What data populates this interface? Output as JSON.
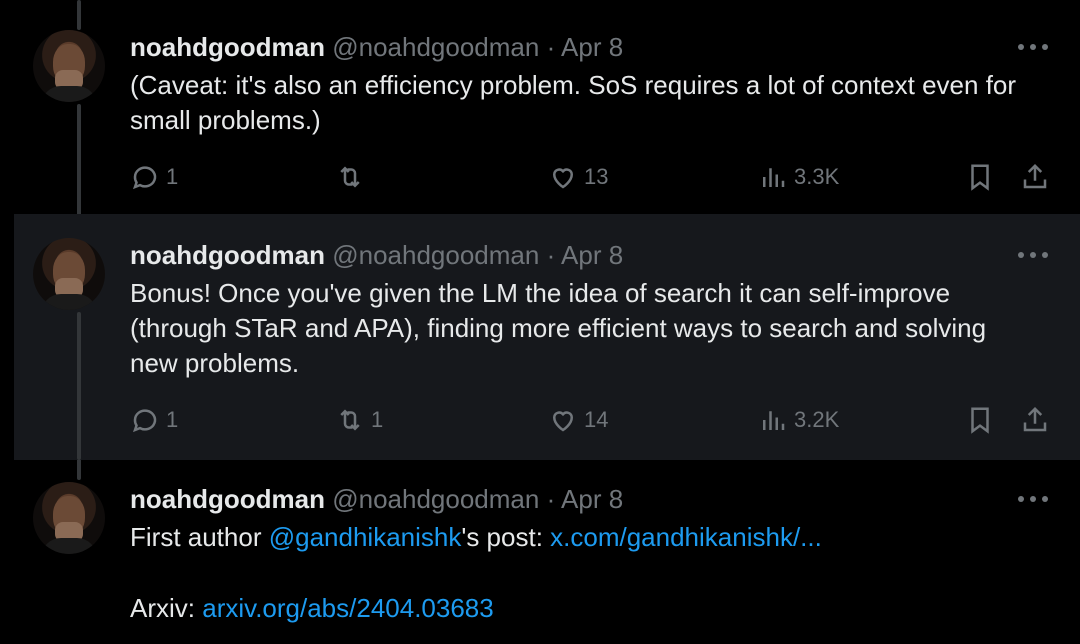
{
  "tweets": [
    {
      "name": "noahdgoodman",
      "handle": "@noahdgoodman",
      "sep": "·",
      "date": "Apr 8",
      "text": "(Caveat: it's also an efficiency problem. SoS requires a lot of context even for small problems.)",
      "replies": "1",
      "reposts": "",
      "likes": "13",
      "views": "3.3K"
    },
    {
      "name": "noahdgoodman",
      "handle": "@noahdgoodman",
      "sep": "·",
      "date": "Apr 8",
      "text": "Bonus! Once you've given the LM the idea of search it can self-improve (through STaR and APA), finding more efficient ways to search and solving new problems.",
      "replies": "1",
      "reposts": "1",
      "likes": "14",
      "views": "3.2K"
    },
    {
      "name": "noahdgoodman",
      "handle": "@noahdgoodman",
      "sep": "·",
      "date": "Apr 8",
      "line1_prefix": "First author ",
      "mention": "@gandhikanishk",
      "line1_mid": "'s post: ",
      "post_link": "x.com/gandhikanishk/...",
      "line2_prefix": "Arxiv: ",
      "arxiv_link": "arxiv.org/abs/2404.03683"
    }
  ],
  "icons": {
    "reply": "reply-icon",
    "repost": "repost-icon",
    "like": "heart-icon",
    "views": "views-icon",
    "bookmark": "bookmark-icon",
    "share": "share-icon",
    "more": "more-icon"
  },
  "colors": {
    "background": "#000000",
    "highlight_background": "#16181c",
    "text": "#e7e9ea",
    "muted": "#71767b",
    "link": "#1d9bf0"
  }
}
